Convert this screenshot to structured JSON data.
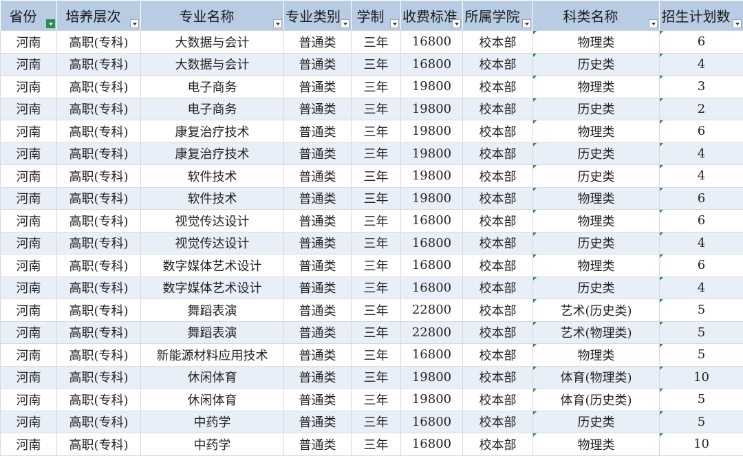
{
  "columns": [
    "省份",
    "培养层次",
    "专业名称",
    "专业类别",
    "学制",
    "收费标准",
    "所属学院",
    "科类名称",
    "招生计划数"
  ],
  "rows": [
    [
      "河南",
      "高职(专科)",
      "大数据与会计",
      "普通类",
      "三年",
      "16800",
      "校本部",
      "物理类",
      "6"
    ],
    [
      "河南",
      "高职(专科)",
      "大数据与会计",
      "普通类",
      "三年",
      "16800",
      "校本部",
      "历史类",
      "4"
    ],
    [
      "河南",
      "高职(专科)",
      "电子商务",
      "普通类",
      "三年",
      "19800",
      "校本部",
      "物理类",
      "3"
    ],
    [
      "河南",
      "高职(专科)",
      "电子商务",
      "普通类",
      "三年",
      "19800",
      "校本部",
      "历史类",
      "2"
    ],
    [
      "河南",
      "高职(专科)",
      "康复治疗技术",
      "普通类",
      "三年",
      "19800",
      "校本部",
      "物理类",
      "6"
    ],
    [
      "河南",
      "高职(专科)",
      "康复治疗技术",
      "普通类",
      "三年",
      "19800",
      "校本部",
      "历史类",
      "4"
    ],
    [
      "河南",
      "高职(专科)",
      "软件技术",
      "普通类",
      "三年",
      "19800",
      "校本部",
      "历史类",
      "4"
    ],
    [
      "河南",
      "高职(专科)",
      "软件技术",
      "普通类",
      "三年",
      "19800",
      "校本部",
      "物理类",
      "6"
    ],
    [
      "河南",
      "高职(专科)",
      "视觉传达设计",
      "普通类",
      "三年",
      "16800",
      "校本部",
      "物理类",
      "6"
    ],
    [
      "河南",
      "高职(专科)",
      "视觉传达设计",
      "普通类",
      "三年",
      "16800",
      "校本部",
      "历史类",
      "4"
    ],
    [
      "河南",
      "高职(专科)",
      "数字媒体艺术设计",
      "普通类",
      "三年",
      "16800",
      "校本部",
      "物理类",
      "6"
    ],
    [
      "河南",
      "高职(专科)",
      "数字媒体艺术设计",
      "普通类",
      "三年",
      "16800",
      "校本部",
      "历史类",
      "4"
    ],
    [
      "河南",
      "高职(专科)",
      "舞蹈表演",
      "普通类",
      "三年",
      "22800",
      "校本部",
      "艺术(历史类)",
      "5"
    ],
    [
      "河南",
      "高职(专科)",
      "舞蹈表演",
      "普通类",
      "三年",
      "22800",
      "校本部",
      "艺术(物理类)",
      "5"
    ],
    [
      "河南",
      "高职(专科)",
      "新能源材料应用技术",
      "普通类",
      "三年",
      "16800",
      "校本部",
      "物理类",
      "5"
    ],
    [
      "河南",
      "高职(专科)",
      "休闲体育",
      "普通类",
      "三年",
      "19800",
      "校本部",
      "体育(物理类)",
      "10"
    ],
    [
      "河南",
      "高职(专科)",
      "休闲体育",
      "普通类",
      "三年",
      "19800",
      "校本部",
      "体育(历史类)",
      "5"
    ],
    [
      "河南",
      "高职(专科)",
      "中药学",
      "普通类",
      "三年",
      "16800",
      "校本部",
      "历史类",
      "5"
    ],
    [
      "河南",
      "高职(专科)",
      "中药学",
      "普通类",
      "三年",
      "16800",
      "校本部",
      "物理类",
      "10"
    ]
  ],
  "colors": {
    "header_bg": "#b8cce4",
    "alt_row_bg": "#e9eff8",
    "filter_active": "#2e8b57"
  },
  "filter_active_column": 0
}
